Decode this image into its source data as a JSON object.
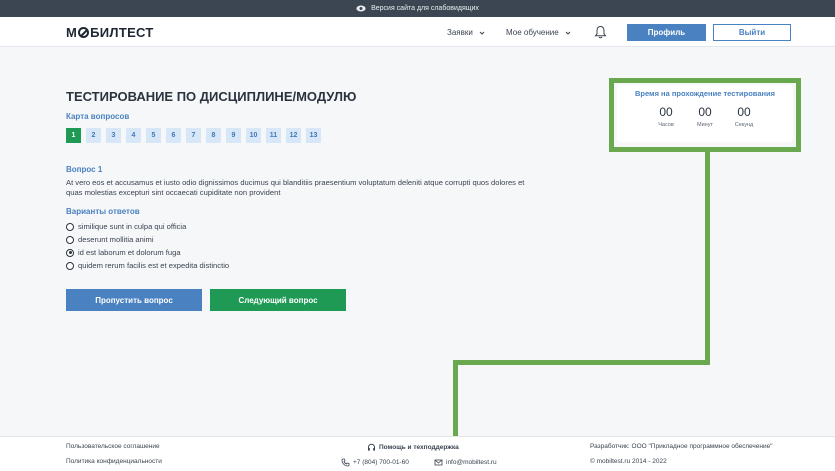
{
  "accessibility": {
    "label": "Версия сайта для слабовидящих",
    "icon": "eye-icon"
  },
  "header": {
    "logo_pre": "М",
    "logo_post": "БИЛТЕСТ",
    "nav": [
      {
        "label": "Заявки",
        "icon": "chevron-down-icon"
      },
      {
        "label": "Мое обучение",
        "icon": "chevron-down-icon"
      }
    ],
    "bell_icon": "bell-icon",
    "profile_label": "Профиль",
    "exit_label": "Выйти"
  },
  "main": {
    "title": "ТЕСТИРОВАНИЕ ПО ДИСЦИПЛИНЕ/МОДУЛЮ",
    "map_label": "Карта вопросов",
    "question_numbers": [
      "1",
      "2",
      "3",
      "4",
      "5",
      "6",
      "7",
      "8",
      "9",
      "10",
      "11",
      "12",
      "13"
    ],
    "active_question": "1",
    "question_title": "Вопрос 1",
    "question_text": "At vero eos et accusamus et iusto odio dignissimos ducimus qui blanditiis praesentium voluptatum deleniti atque corrupti quos dolores et quas molestias excepturi sint occaecati cupiditate non provident",
    "answers_label": "Варианты ответов",
    "answers": [
      {
        "text": "similique sunt in culpa qui officia",
        "selected": false
      },
      {
        "text": "deserunt mollitia animi",
        "selected": false
      },
      {
        "text": "id est laborum et dolorum fuga",
        "selected": true
      },
      {
        "text": "quidem rerum facilis est et expedita distinctio",
        "selected": false
      }
    ],
    "skip_label": "Пропустить вопрос",
    "next_label": "Следующий вопрос"
  },
  "timer": {
    "title": "Время на прохождение тестирования",
    "hours": "00",
    "minutes": "00",
    "seconds": "00",
    "hours_label": "Часов",
    "minutes_label": "Минут",
    "seconds_label": "Секунд"
  },
  "footer": {
    "agreement": "Пользовательское соглашение",
    "privacy": "Политика конфиденциальности",
    "support_title": "Помощь и техподдержка",
    "phone": "+7 (804) 700-01-60",
    "email": "info@mobiltest.ru",
    "developer": "Разработчик: ООО \"Прикладное программное обеспечение\"",
    "copyright": "© mobiltest.ru 2014 - 2022"
  },
  "colors": {
    "accent": "#4a81c0",
    "success": "#1e9a55",
    "annotation": "#6aa84f",
    "topbar": "#3c4652"
  }
}
